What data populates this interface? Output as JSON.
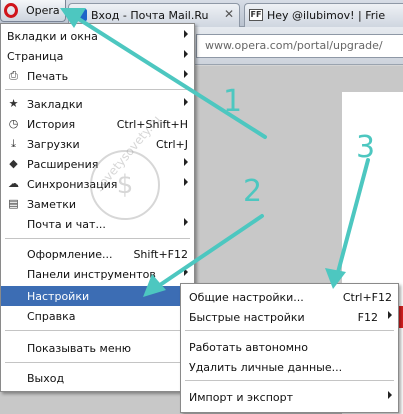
{
  "opera_button": {
    "label": "Opera"
  },
  "tabs": [
    {
      "label": "Вход - Почта Mail.Ru",
      "icon": "mail-ru-icon"
    },
    {
      "label": "Hey @ilubimov! | Friend ...",
      "icon": "friendfeed-icon",
      "favicon_text": "FF"
    }
  ],
  "address_bar": {
    "value": "www.opera.com/portal/upgrade/"
  },
  "main_menu": {
    "items": [
      {
        "label": "Вкладки и окна",
        "submenu": true
      },
      {
        "label": "Страница",
        "submenu": true
      },
      {
        "label": "Печать",
        "submenu": true,
        "icon": "printer-icon"
      },
      {
        "label": "Закладки",
        "submenu": true,
        "icon": "star-icon"
      },
      {
        "label": "История",
        "shortcut": "Ctrl+Shift+H",
        "icon": "clock-icon"
      },
      {
        "label": "Загрузки",
        "shortcut": "Ctrl+J",
        "icon": "download-icon"
      },
      {
        "label": "Расширения",
        "submenu": true,
        "icon": "extensions-icon"
      },
      {
        "label": "Синхронизация",
        "submenu": true,
        "icon": "cloud-icon"
      },
      {
        "label": "Заметки",
        "icon": "notes-icon"
      },
      {
        "label": "Почта и чат...",
        "submenu": true
      },
      {
        "label": "Оформление...",
        "shortcut": "Shift+F12"
      },
      {
        "label": "Панели инструментов",
        "submenu": true
      },
      {
        "label": "Настройки",
        "submenu": true,
        "highlighted": true
      },
      {
        "label": "Справка",
        "submenu": true
      },
      {
        "label": "Показывать меню"
      },
      {
        "label": "Выход"
      }
    ]
  },
  "settings_submenu": {
    "items": [
      {
        "label": "Общие настройки...",
        "shortcut": "Ctrl+F12"
      },
      {
        "label": "Быстрые настройки",
        "shortcut": "F12",
        "submenu": true
      },
      {
        "label": "Работать автономно"
      },
      {
        "label": "Удалить личные данные..."
      },
      {
        "label": "Импорт и экспорт",
        "submenu": true
      }
    ]
  },
  "annotations": {
    "step1": "1",
    "step2": "2",
    "step3": "3",
    "watermark": "sovetysovety.ru",
    "arrow_color": "#4dc7c0"
  },
  "colors": {
    "highlight": "#3c6db4",
    "opera_red": "#d0141b"
  }
}
